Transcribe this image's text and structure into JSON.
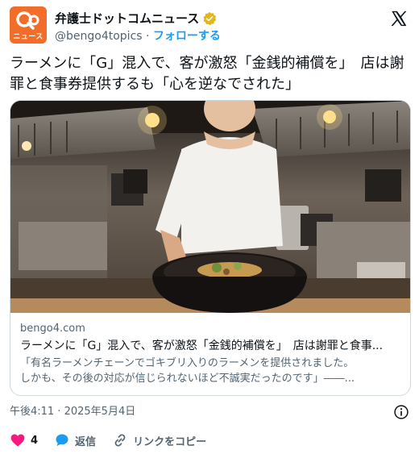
{
  "account": {
    "name": "弁護士ドットコムニュース",
    "handle": "@bengo4topics",
    "separator": " · ",
    "follow_label": "フォローする",
    "avatar_text": "ニュース",
    "verified_color": "#e2b719",
    "avatar_color": "#f26d2a"
  },
  "tweet": {
    "text": "ラーメンに「G」混入で、客が激怒「金銭的補償を」　店は謝罪と食事券提供するも「心を逆なでされた」"
  },
  "card": {
    "domain": "bengo4.com",
    "title": "ラーメンに「G」混入で、客が激怒「金銭的補償を」　店は謝罪と食事...",
    "description_line1": "「有名ラーメンチェーンでゴキブリ入りのラーメンを提供されました。",
    "description_line2": "しかも、その後の対応が信じられないほど不誠実だったのです」――..."
  },
  "timestamp": "午後4:11 · 2025年5月4日",
  "actions": {
    "like_count": "4",
    "reply_label": "返信",
    "copy_link_label": "リンクをコピー"
  },
  "icons": {
    "logo": "x-logo-icon",
    "info": "info-icon",
    "like": "heart-icon",
    "reply": "speech-bubble-icon",
    "link": "link-icon"
  },
  "colors": {
    "accent": "#1d9bf0",
    "like": "#f91880",
    "text_secondary": "#536471"
  }
}
